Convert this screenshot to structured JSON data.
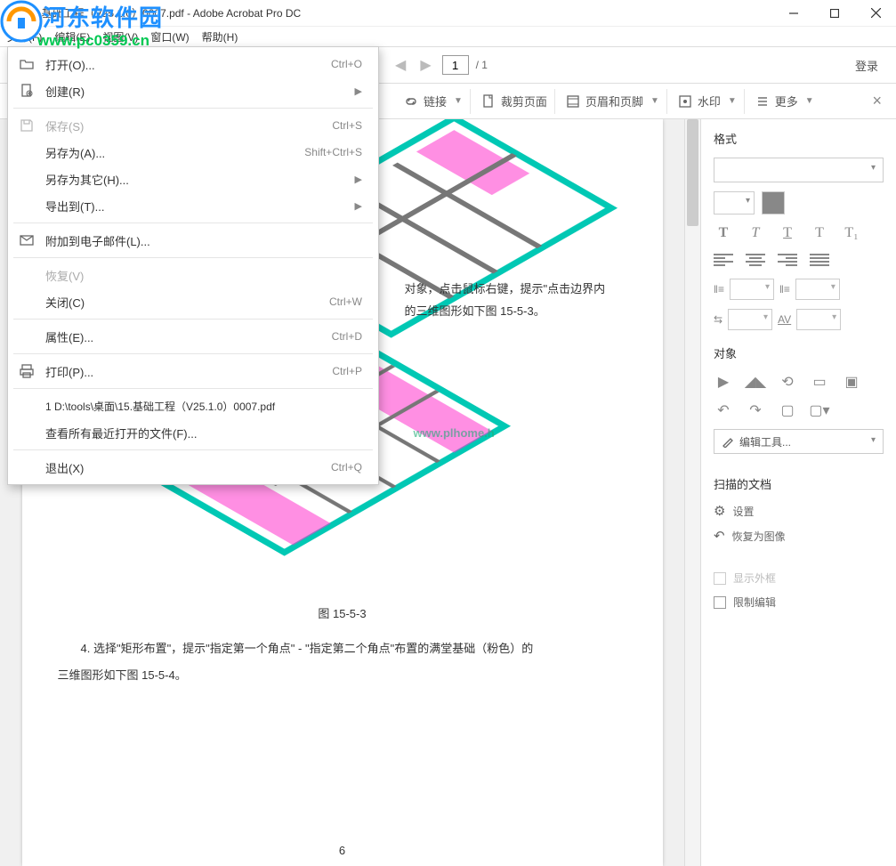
{
  "window": {
    "title": "15.基础工程（V25.1.0）0007.pdf - Adobe Acrobat Pro DC"
  },
  "menubar": {
    "file": "文件(F)",
    "edit": "编辑(E)",
    "view": "视图(V)",
    "window": "窗口(W)",
    "help": "帮助(H)"
  },
  "page_nav": {
    "current": "1",
    "total": "/ 1",
    "login": "登录"
  },
  "toolbar": {
    "link": "链接",
    "crop": "裁剪页面",
    "header_footer": "页眉和页脚",
    "watermark": "水印",
    "more": "更多"
  },
  "file_menu": {
    "open": "打开(O)...",
    "open_shortcut": "Ctrl+O",
    "create": "创建(R)",
    "save": "保存(S)",
    "save_shortcut": "Ctrl+S",
    "save_as": "另存为(A)...",
    "save_as_shortcut": "Shift+Ctrl+S",
    "save_as_other": "另存为其它(H)...",
    "export_to": "导出到(T)...",
    "attach_email": "附加到电子邮件(L)...",
    "revert": "恢复(V)",
    "close": "关闭(C)",
    "close_shortcut": "Ctrl+W",
    "properties": "属性(E)...",
    "properties_shortcut": "Ctrl+D",
    "print": "打印(P)...",
    "print_shortcut": "Ctrl+P",
    "recent1": "1 D:\\tools\\桌面\\15.基础工程（V25.1.0）0007.pdf",
    "view_recent": "查看所有最近打开的文件(F)...",
    "exit": "退出(X)",
    "exit_shortcut": "Ctrl+Q"
  },
  "side": {
    "format": "格式",
    "object": "对象",
    "edit_tools": "编辑工具...",
    "scanned": "扫描的文档",
    "settings": "设置",
    "restore_image": "恢复为图像",
    "show_bbox": "显示外框",
    "limit_edit": "限制编辑"
  },
  "doc": {
    "text1": "对象，点击鼠标右键，提示\"点击边界内",
    "text2": "的三维图形如下图 15-5-3。",
    "caption": "图 15-5-3",
    "para4": "4. 选择\"矩形布置\"，提示\"指定第一个角点\" - \"指定第二个角点\"布置的满堂基础（粉色）的",
    "para4b": "三维图形如下图 15-5-4。",
    "page_number": "6",
    "wm": "www.plhome.h"
  },
  "overlay_watermark": {
    "line1": "河东软件园",
    "line2": "www.pc0359.cn"
  }
}
